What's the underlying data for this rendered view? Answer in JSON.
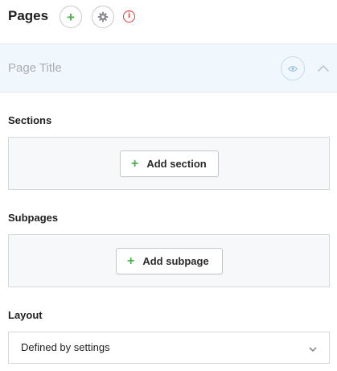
{
  "header": {
    "title": "Pages",
    "add_page_glyph": "+",
    "settings_icon": "gear-icon",
    "info_icon": "info-icon",
    "info_glyph": "i",
    "info_color": "#e53935"
  },
  "page_title": {
    "placeholder": "Page Title",
    "visibility_icon": "eye-icon",
    "collapse_icon": "chevron-up-icon",
    "background": "#f1f8fd"
  },
  "sections": {
    "label": "Sections",
    "add_glyph": "+",
    "add_label": "Add section"
  },
  "subpages": {
    "label": "Subpages",
    "add_glyph": "+",
    "add_label": "Add subpage"
  },
  "layout": {
    "label": "Layout",
    "selected": "Defined by settings",
    "dropdown_icon": "chevron-down-icon"
  },
  "colors": {
    "accent_green": "#4caf50",
    "alert_red": "#e53935",
    "muted_text": "#a9adb2"
  }
}
